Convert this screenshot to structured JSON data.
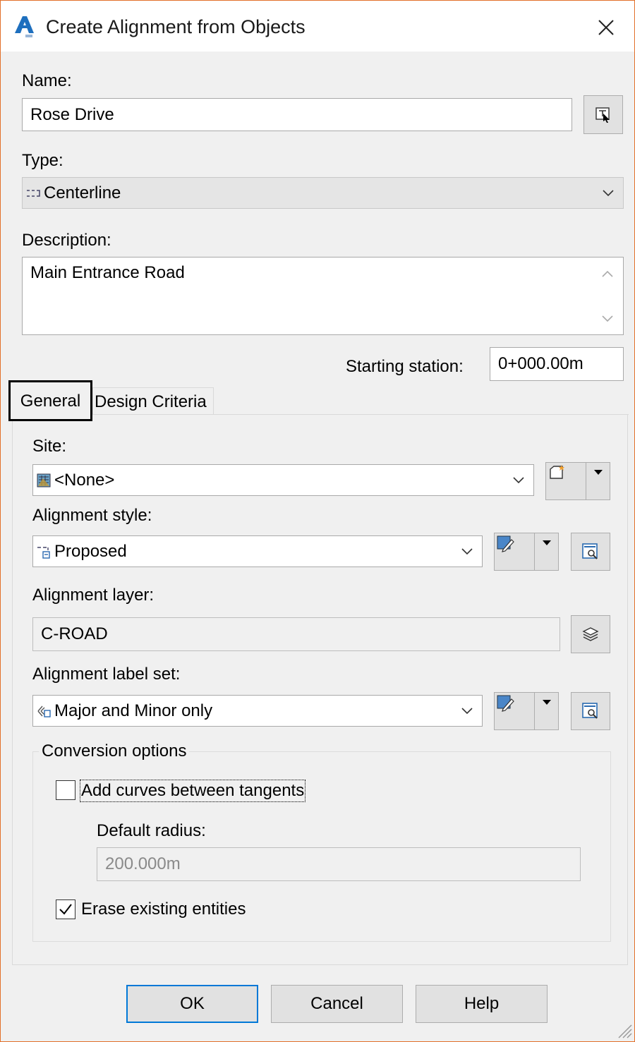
{
  "window": {
    "title": "Create Alignment from Objects"
  },
  "name": {
    "label": "Name:",
    "value": "Rose Drive"
  },
  "type": {
    "label": "Type:",
    "value": "Centerline"
  },
  "description": {
    "label": "Description:",
    "value": "Main Entrance Road"
  },
  "starting_station": {
    "label": "Starting station:",
    "value": "0+000.00m"
  },
  "tabs": [
    {
      "label": "General",
      "selected": true
    },
    {
      "label": "Design Criteria",
      "selected": false
    }
  ],
  "general": {
    "site": {
      "label": "Site:",
      "value": "<None>"
    },
    "alignment_style": {
      "label": "Alignment style:",
      "value": "Proposed"
    },
    "alignment_layer": {
      "label": "Alignment layer:",
      "value": "C-ROAD"
    },
    "alignment_label_set": {
      "label": "Alignment label set:",
      "value": "Major and Minor only"
    },
    "conversion": {
      "title": "Conversion options",
      "add_curves": {
        "label": "Add curves between tangents",
        "checked": false
      },
      "default_radius": {
        "label": "Default radius:",
        "value": "200.000m"
      },
      "erase_existing": {
        "label": "Erase existing entities",
        "checked": true
      }
    }
  },
  "buttons": {
    "ok": "OK",
    "cancel": "Cancel",
    "help": "Help"
  },
  "colors": {
    "window_border": "#e3702a",
    "accent": "#0078d7",
    "app_icon": "#1e6fbe"
  },
  "icons": [
    "autocad-a-icon",
    "close-icon",
    "pick-from-drawing-icon",
    "alignment-type-icon",
    "site-icon",
    "create-site-icon",
    "alignment-style-icon",
    "edit-style-icon",
    "browse-style-icon",
    "layer-icon",
    "label-set-icon",
    "checkmark-icon",
    "resize-grip-icon"
  ]
}
